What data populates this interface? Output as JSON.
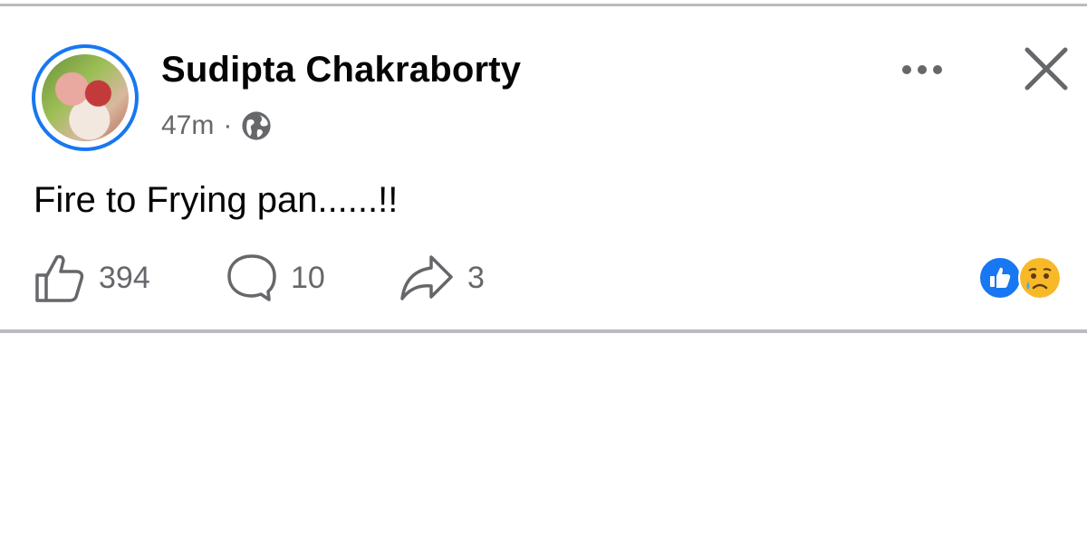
{
  "post": {
    "author": "Sudipta Chakraborty",
    "time": "47m",
    "separator": "·",
    "privacy_icon": "globe-icon",
    "message": "Fire to Frying pan......!!",
    "more_icon": "more-options-icon",
    "close_icon": "close-icon"
  },
  "stats": {
    "likes": "394",
    "comments": "10",
    "shares": "3"
  },
  "reactions": [
    "like-reaction-icon",
    "sad-reaction-icon"
  ],
  "colors": {
    "accent": "#1877f2",
    "text": "#050505",
    "secondary_text": "#65676b",
    "divider": "#b9bcc1",
    "sad_face": "#f7b928"
  }
}
